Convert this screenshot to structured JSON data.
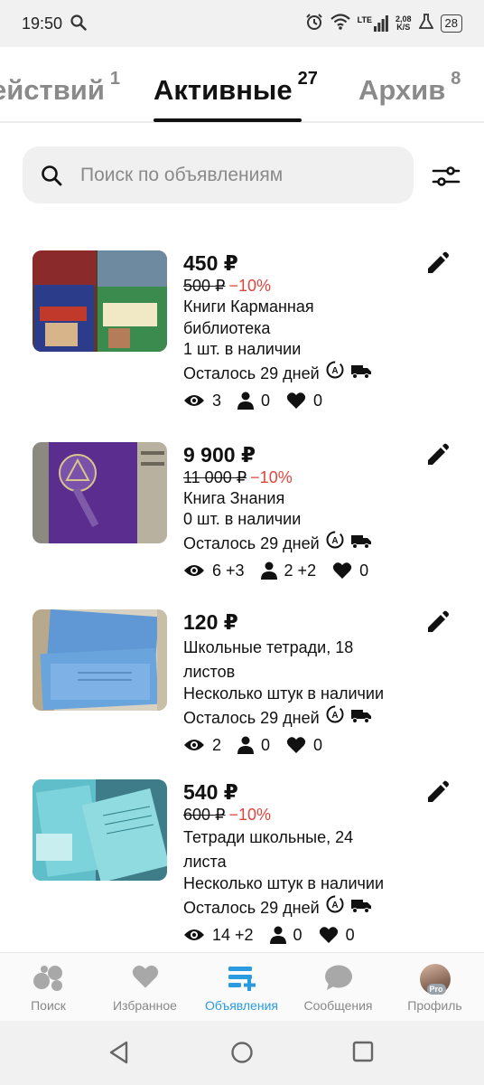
{
  "status_bar": {
    "time": "19:50",
    "net_speed_value": "2,08",
    "net_speed_unit": "K/S",
    "network": "LTE",
    "battery": "28"
  },
  "tabs": [
    {
      "label": "ействий",
      "count": "1"
    },
    {
      "label": "Активные",
      "count": "27"
    },
    {
      "label": "Архив",
      "count": "8"
    }
  ],
  "search": {
    "placeholder": "Поиск по объявлениям"
  },
  "listings": [
    {
      "price": "450 ₽",
      "old_price": "500 ₽",
      "discount": "−10%",
      "title_line1": "Книги Карманная",
      "title_line2": "библиотека",
      "stock": "1 шт. в наличии",
      "remaining": "Осталось 29 дней",
      "views": "3",
      "contacts": "0",
      "favorites": "0"
    },
    {
      "price": "9 900 ₽",
      "old_price": "11 000 ₽",
      "discount": "−10%",
      "title_line1": "Книга Знания",
      "title_line2": "",
      "stock": "0 шт. в наличии",
      "remaining": "Осталось 29 дней",
      "views": "6 +3",
      "contacts": "2 +2",
      "favorites": "0"
    },
    {
      "price": "120 ₽",
      "old_price": "",
      "discount": "",
      "title_line1": "Школьные тетради, 18",
      "title_line2": "листов",
      "stock": "Несколько штук в наличии",
      "remaining": "Осталось 29 дней",
      "views": "2",
      "contacts": "0",
      "favorites": "0"
    },
    {
      "price": "540 ₽",
      "old_price": "600 ₽",
      "discount": "−10%",
      "title_line1": "Тетради школьные, 24",
      "title_line2": "листа",
      "stock": "Несколько штук в наличии",
      "remaining": "Осталось 29 дней",
      "views": "14 +2",
      "contacts": "0",
      "favorites": "0"
    }
  ],
  "bottom_nav": [
    {
      "label": "Поиск",
      "icon": "search-bubbles-icon"
    },
    {
      "label": "Избранное",
      "icon": "heart-icon"
    },
    {
      "label": "Объявления",
      "icon": "listings-add-icon",
      "active": true
    },
    {
      "label": "Сообщения",
      "icon": "chat-bubble-icon"
    },
    {
      "label": "Профиль",
      "icon": "avatar",
      "badge": "Pro"
    }
  ],
  "colors": {
    "accent": "#2a9be0",
    "discount": "#e0453d",
    "inactive_tab": "#8a8a8a"
  }
}
